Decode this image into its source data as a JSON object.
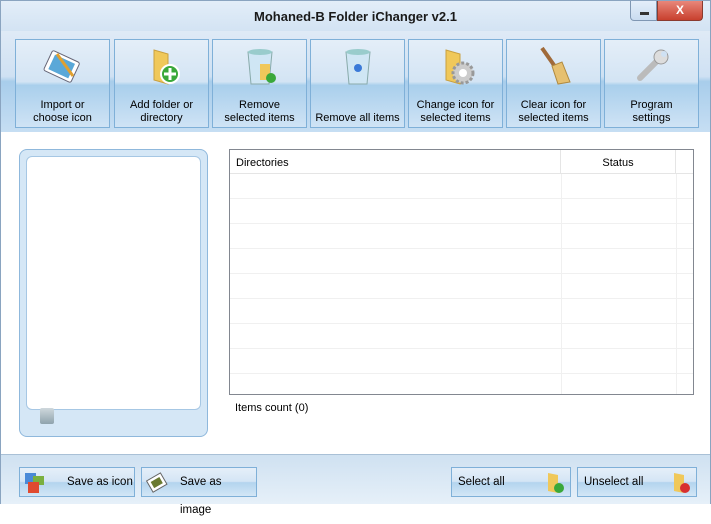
{
  "window": {
    "title": "Mohaned-B Folder iChanger v2.1",
    "minimize_icon": "minimize-icon",
    "close_label": "X"
  },
  "toolbar": [
    {
      "id": "import",
      "line1": "Import or",
      "line2": "choose icon",
      "icon": "image-edit-icon"
    },
    {
      "id": "add-folder",
      "line1": "Add folder or",
      "line2": "directory",
      "icon": "folder-add-icon"
    },
    {
      "id": "remove-selected",
      "line1": "Remove",
      "line2": "selected items",
      "icon": "recycle-bin-check-icon"
    },
    {
      "id": "remove-all",
      "line1": "",
      "line2": "Remove all items",
      "icon": "recycle-bin-icon"
    },
    {
      "id": "change-icon",
      "line1": "Change icon for",
      "line2": "selected items",
      "icon": "folder-gear-icon"
    },
    {
      "id": "clear-icon",
      "line1": "Clear icon for",
      "line2": "selected items",
      "icon": "broom-icon"
    },
    {
      "id": "settings",
      "line1": "Program",
      "line2": "settings",
      "icon": "wrench-icon"
    }
  ],
  "table": {
    "columns": [
      "Directories",
      "Status"
    ],
    "rows": []
  },
  "items_count": "Items count (0)",
  "bottom": {
    "save_icon": "Save as icon",
    "save_image": "Save as image",
    "select_all": "Select all",
    "unselect_all": "Unselect all"
  },
  "colors": {
    "accent": "#a9cfec",
    "border": "#7fb0d8",
    "close": "#c8402e"
  }
}
